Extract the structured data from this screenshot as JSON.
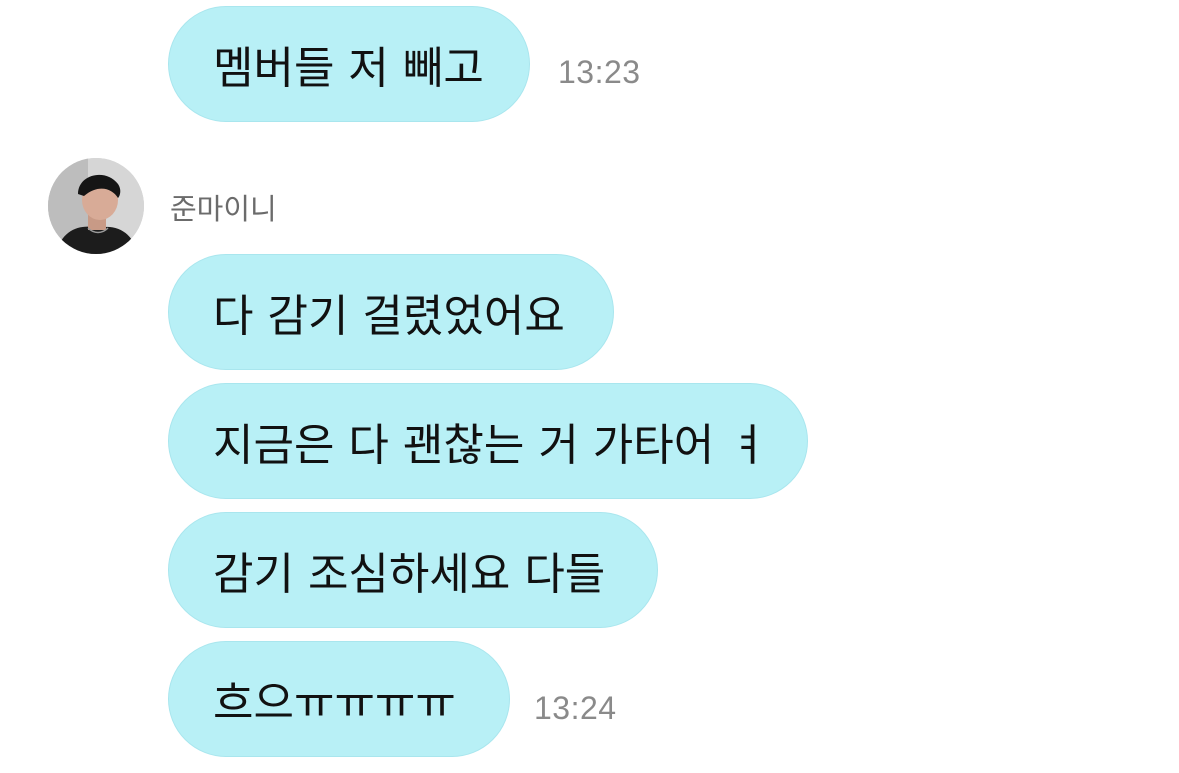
{
  "chat": {
    "messages_before": [
      {
        "text": "멤버들 저 빼고",
        "time": "13:23"
      }
    ],
    "sender": {
      "name": "준마이니",
      "avatar_icon": "profile-photo-avatar"
    },
    "messages": [
      {
        "text": "다 감기 걸렸었어요"
      },
      {
        "text": "지금은 다 괜찮는 거 가타어 ㅕ"
      },
      {
        "text": "감기 조심하세요 다들"
      },
      {
        "text": "흐으ㅠㅠㅠㅠ",
        "time": "13:24"
      }
    ]
  },
  "colors": {
    "bubble": "#b8f0f6",
    "time_text": "#8a8a8a",
    "sender_text": "#6b6b6b"
  }
}
